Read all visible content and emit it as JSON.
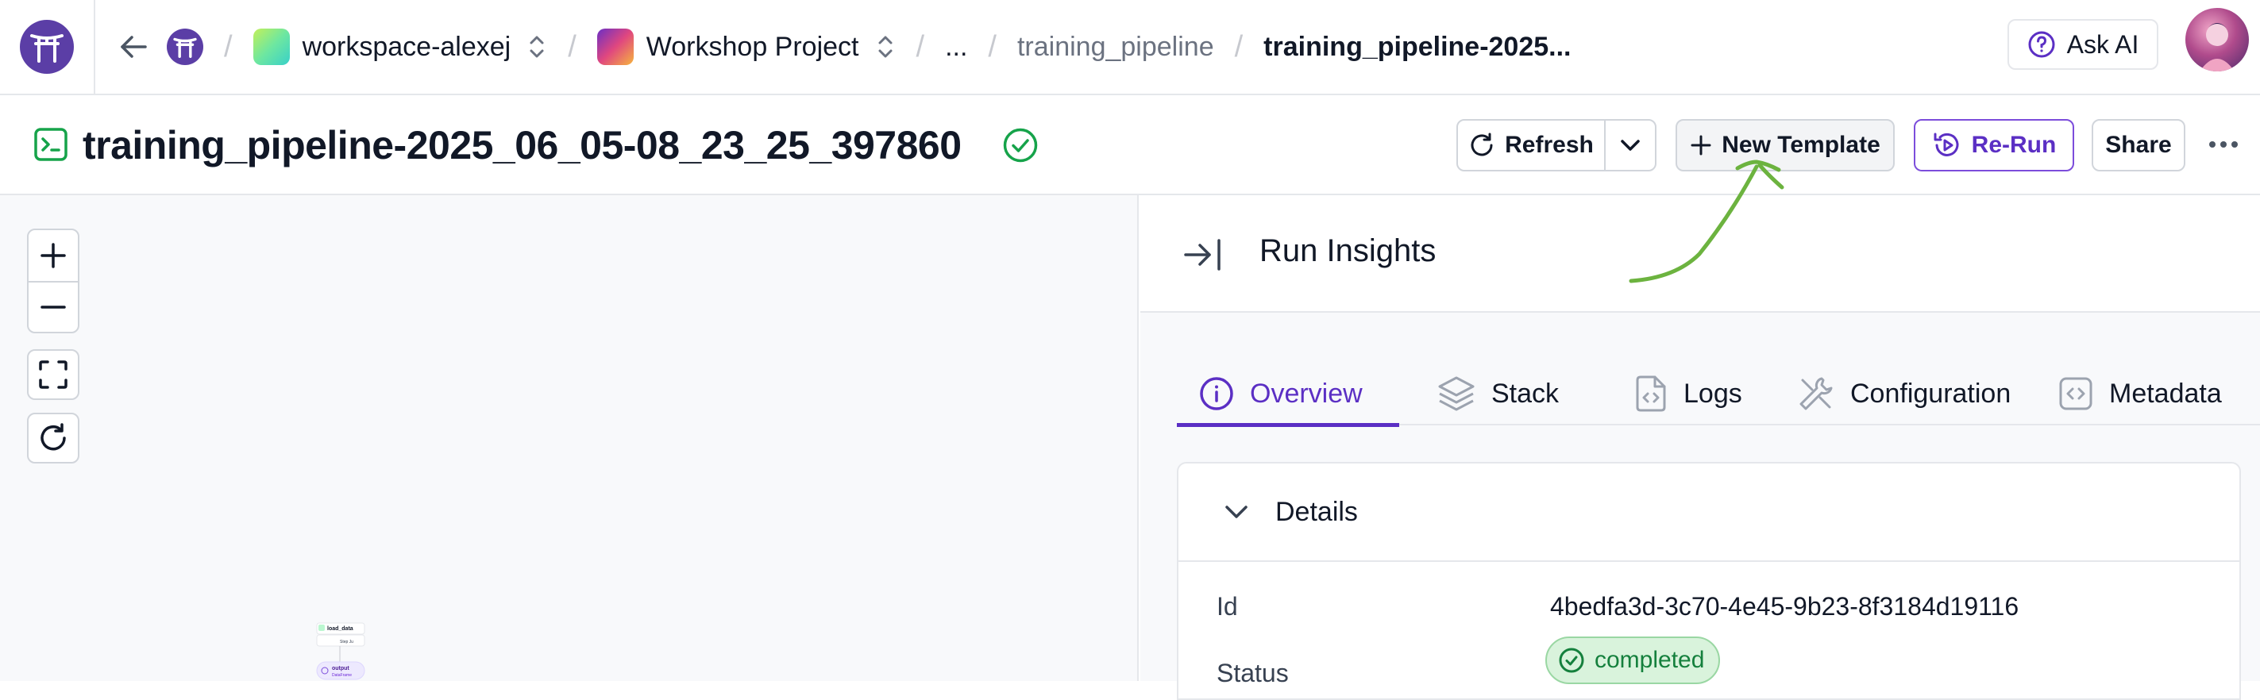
{
  "topbar": {
    "breadcrumbs": {
      "workspace": "workspace-alexej",
      "project": "Workshop Project",
      "ellipsis": "...",
      "pipeline": "training_pipeline",
      "run": "training_pipeline-2025..."
    },
    "ask_ai": "Ask AI"
  },
  "header": {
    "title": "training_pipeline-2025_06_05-08_23_25_397860",
    "buttons": {
      "refresh": "Refresh",
      "new_template": "New Template",
      "rerun": "Re-Run",
      "share": "Share"
    }
  },
  "dag": {
    "nodes": [
      {
        "label": "load_data"
      },
      {
        "label": "Step Ju"
      },
      {
        "label": "output"
      },
      {
        "label": "DataFrame"
      }
    ]
  },
  "panel": {
    "title": "Run Insights",
    "tabs": [
      {
        "label": "Overview",
        "icon": "info-icon",
        "active": true
      },
      {
        "label": "Stack",
        "icon": "layers-icon",
        "active": false
      },
      {
        "label": "Logs",
        "icon": "file-code-icon",
        "active": false
      },
      {
        "label": "Configuration",
        "icon": "wrench-icon",
        "active": false
      },
      {
        "label": "Metadata",
        "icon": "code-icon",
        "active": false
      }
    ],
    "details": {
      "heading": "Details",
      "rows": [
        {
          "label": "Id",
          "value": "4bedfa3d-3c70-4e45-9b23-8f3184d19116"
        },
        {
          "label": "Status",
          "value": "completed"
        }
      ]
    }
  },
  "colors": {
    "accent": "#5b2fc4",
    "success": "#16a34a",
    "annotation": "#6cb33f"
  }
}
